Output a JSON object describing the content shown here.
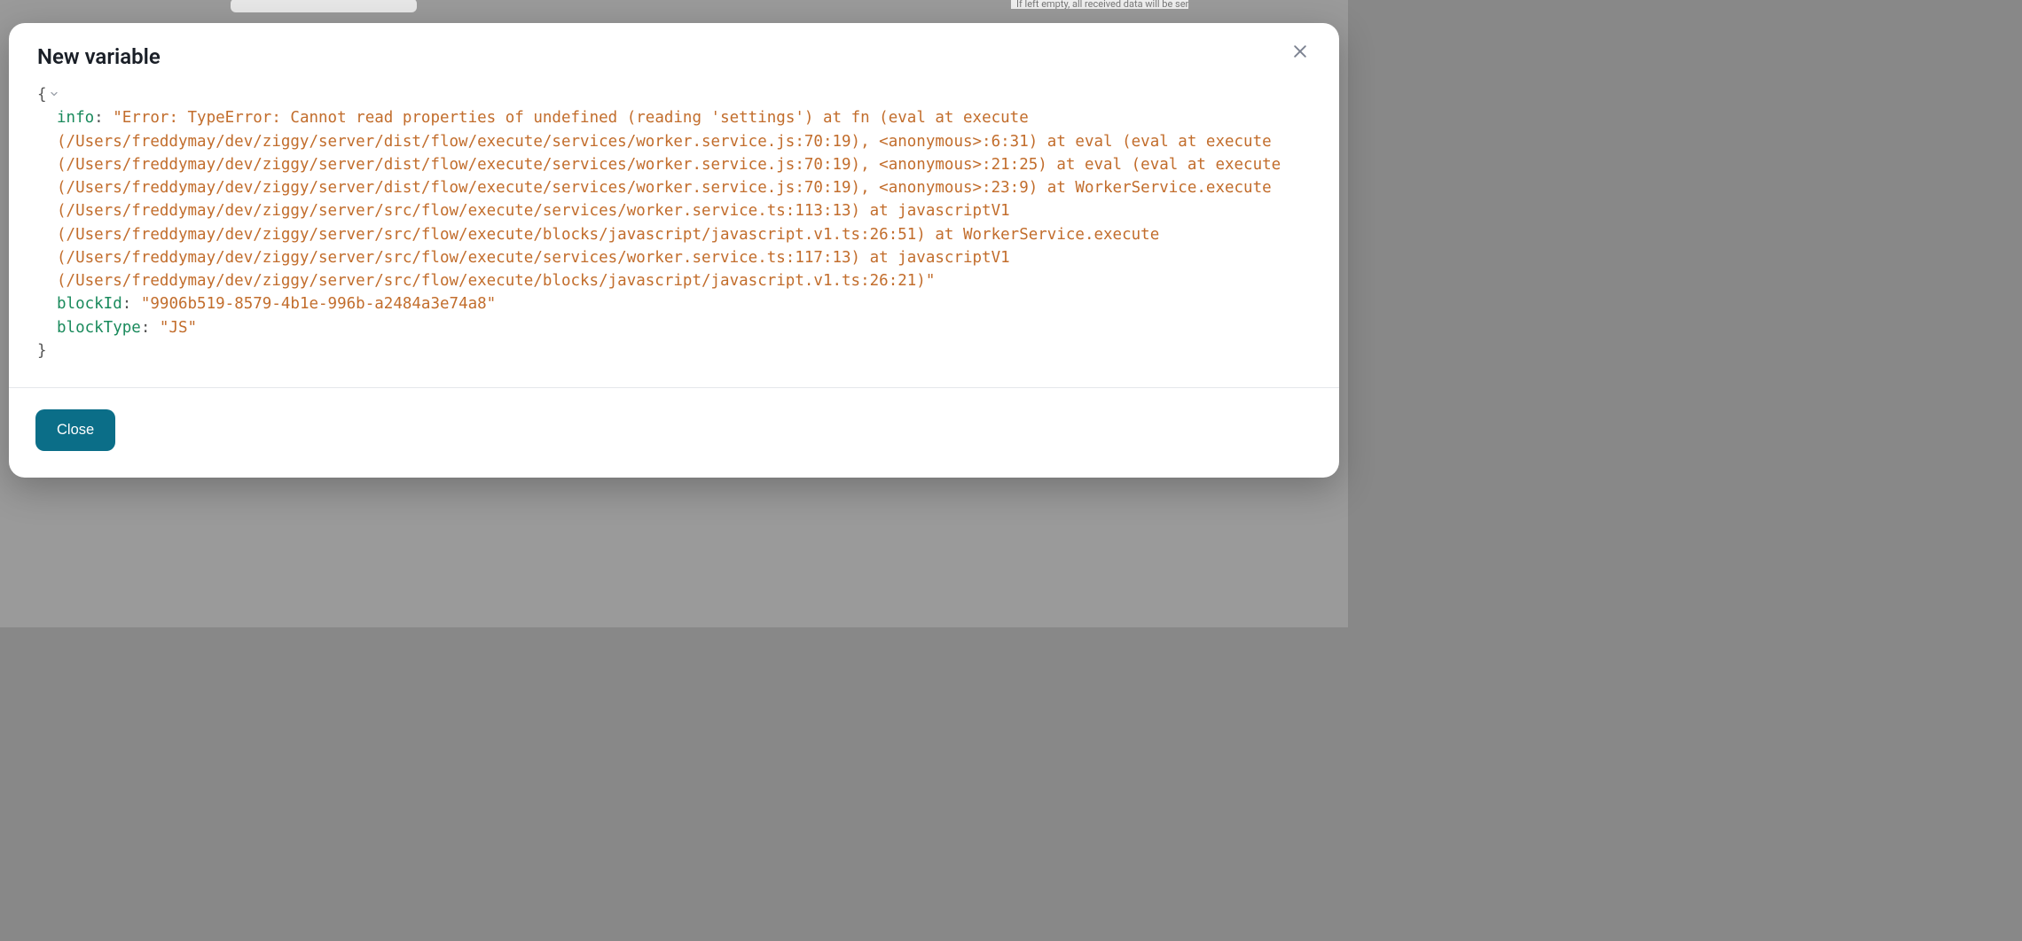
{
  "background": {
    "hint_text": "If left empty, all received data will be sent in"
  },
  "modal": {
    "title": "New variable",
    "close_label": "Close",
    "json": {
      "open_brace": "{",
      "close_brace": "}",
      "entries": [
        {
          "key": "info",
          "value": "\"Error: TypeError: Cannot read properties of undefined (reading 'settings') at fn (eval at execute (/Users/freddymay/dev/ziggy/server/dist/flow/execute/services/worker.service.js:70:19), <anonymous>:6:31) at eval (eval at execute (/Users/freddymay/dev/ziggy/server/dist/flow/execute/services/worker.service.js:70:19), <anonymous>:21:25) at eval (eval at execute (/Users/freddymay/dev/ziggy/server/dist/flow/execute/services/worker.service.js:70:19), <anonymous>:23:9) at WorkerService.execute (/Users/freddymay/dev/ziggy/server/src/flow/execute/services/worker.service.ts:113:13) at javascriptV1 (/Users/freddymay/dev/ziggy/server/src/flow/execute/blocks/javascript/javascript.v1.ts:26:51) at WorkerService.execute (/Users/freddymay/dev/ziggy/server/src/flow/execute/services/worker.service.ts:117:13) at javascriptV1 (/Users/freddymay/dev/ziggy/server/src/flow/execute/blocks/javascript/javascript.v1.ts:26:21)\""
        },
        {
          "key": "blockId",
          "value": "\"9906b519-8579-4b1e-996b-a2484a3e74a8\""
        },
        {
          "key": "blockType",
          "value": "\"JS\""
        }
      ]
    }
  }
}
